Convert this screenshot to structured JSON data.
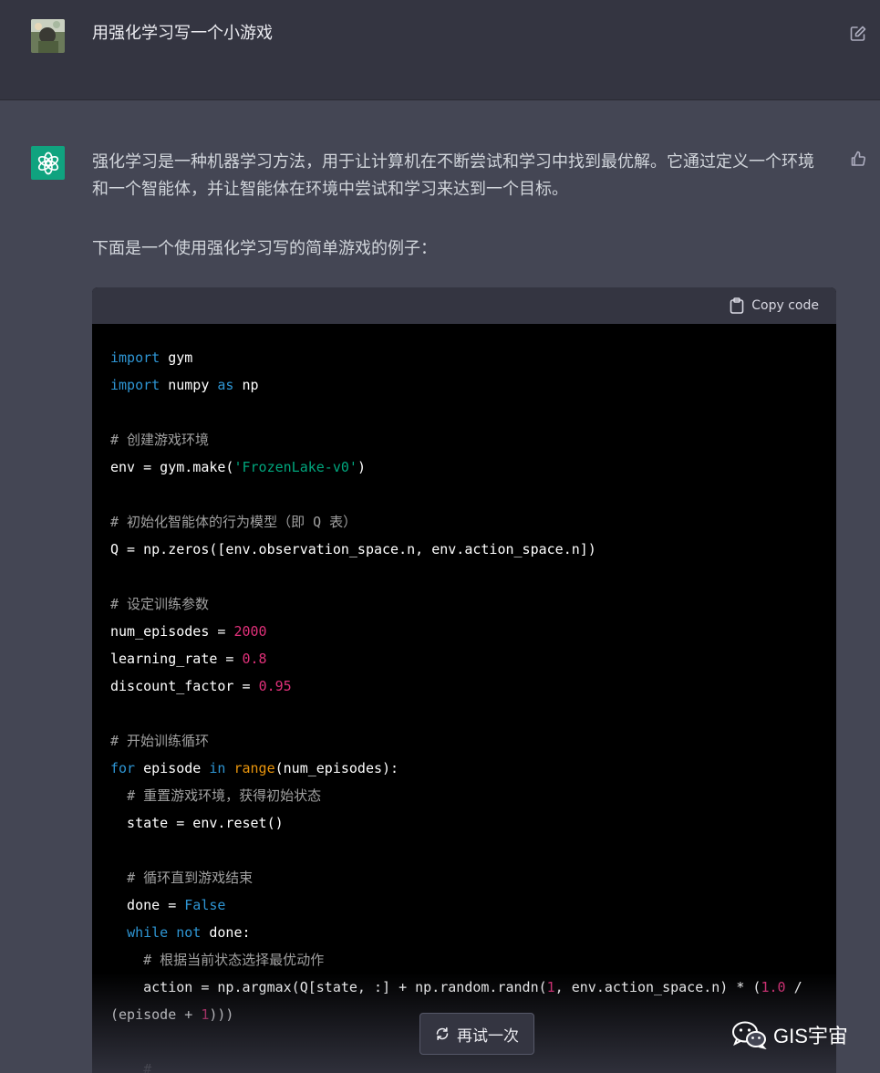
{
  "user_message": {
    "text": "用强化学习写一个小游戏"
  },
  "assistant": {
    "paragraph1": "强化学习是一种机器学习方法，用于让计算机在不断尝试和学习中找到最优解。它通过定义一个环境和一个智能体，并让智能体在环境中尝试和学习来达到一个目标。",
    "paragraph2": "下面是一个使用强化学习写的简单游戏的例子："
  },
  "code_block": {
    "copy_label": "Copy code",
    "lines": [
      "import gym",
      "import numpy as np",
      "",
      "# 创建游戏环境",
      "env = gym.make('FrozenLake-v0')",
      "",
      "# 初始化智能体的行为模型（即 Q 表）",
      "Q = np.zeros([env.observation_space.n, env.action_space.n])",
      "",
      "# 设定训练参数",
      "num_episodes = 2000",
      "learning_rate = 0.8",
      "discount_factor = 0.95",
      "",
      "# 开始训练循环",
      "for episode in range(num_episodes):",
      "  # 重置游戏环境，获得初始状态",
      "  state = env.reset()",
      "",
      "  # 循环直到游戏结束",
      "  done = False",
      "  while not done:",
      "    # 根据当前状态选择最优动作",
      "    action = np.argmax(Q[state, :] + np.random.randn(1, env.action_space.n) * (1.0 /",
      "(episode + 1)))",
      "",
      "    #"
    ]
  },
  "retry_button": {
    "label": "再试一次"
  },
  "watermark": {
    "text": "GIS宇宙"
  }
}
